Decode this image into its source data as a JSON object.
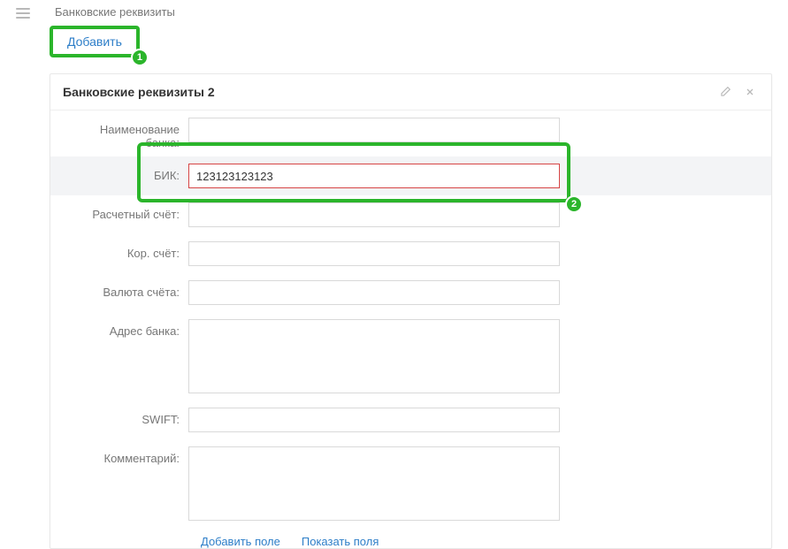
{
  "sectionTitle": "Банковские реквизиты",
  "addButton": "Добавить",
  "annotations": {
    "badge1": "1",
    "badge2": "2"
  },
  "card": {
    "title": "Банковские реквизиты 2",
    "fields": {
      "bankName": {
        "label": "Наименование банка:",
        "value": ""
      },
      "bik": {
        "label": "БИК:",
        "value": "123123123123"
      },
      "account": {
        "label": "Расчетный счёт:",
        "value": ""
      },
      "corr": {
        "label": "Кор. счёт:",
        "value": ""
      },
      "currency": {
        "label": "Валюта счёта:",
        "value": ""
      },
      "address": {
        "label": "Адрес банка:",
        "value": ""
      },
      "swift": {
        "label": "SWIFT:",
        "value": ""
      },
      "comment": {
        "label": "Комментарий:",
        "value": ""
      }
    },
    "bottomLinks": {
      "addField": "Добавить поле",
      "showFields": "Показать поля"
    }
  }
}
